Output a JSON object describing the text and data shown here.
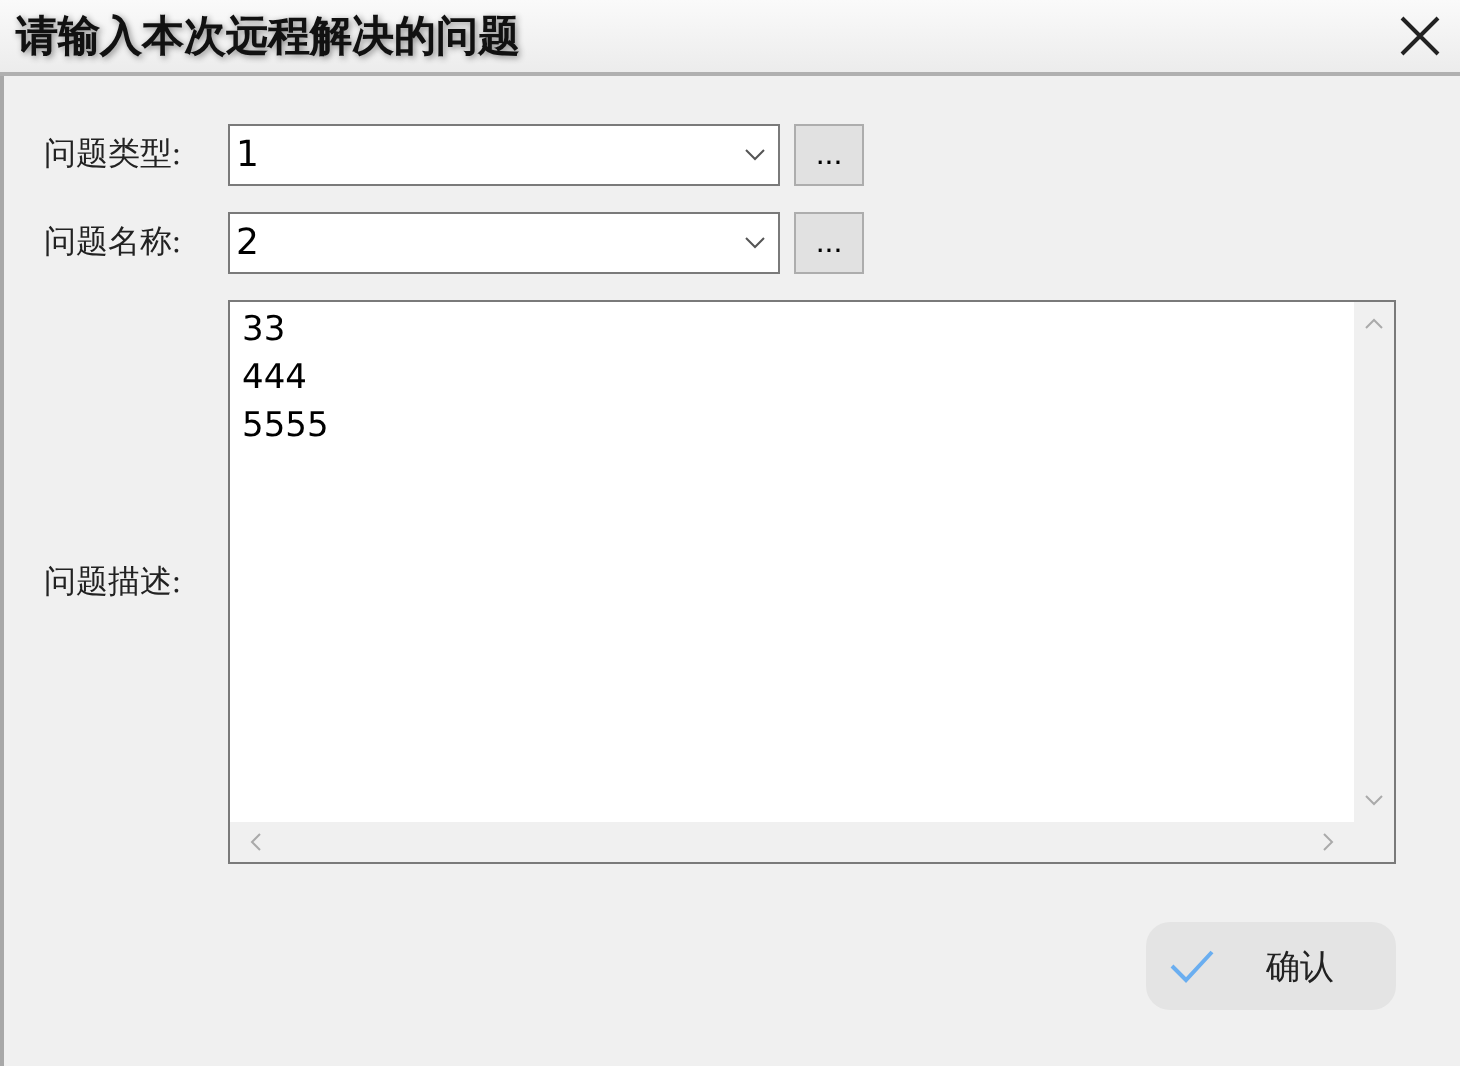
{
  "window": {
    "title": "请输入本次远程解决的问题"
  },
  "fields": [
    {
      "label": "问题类型:",
      "value": "1",
      "browse": "..."
    },
    {
      "label": "问题名称:",
      "value": "2",
      "browse": "..."
    }
  ],
  "description": {
    "label": "问题描述:",
    "value": "33\n444\n5555"
  },
  "confirm_button": {
    "label": "确认"
  }
}
